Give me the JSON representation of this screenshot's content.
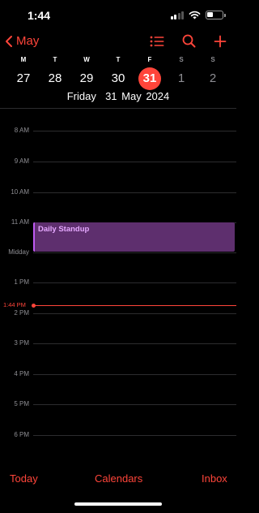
{
  "status_bar": {
    "time": "1:44",
    "icons": [
      "cellular-signal-icon",
      "wifi-icon",
      "battery-icon"
    ]
  },
  "nav": {
    "back_label": "May",
    "actions": [
      "list-icon",
      "search-icon",
      "add-icon"
    ]
  },
  "week": {
    "letters": [
      "M",
      "T",
      "W",
      "T",
      "F",
      "S",
      "S"
    ],
    "days": [
      "27",
      "28",
      "29",
      "30",
      "31",
      "1",
      "2"
    ],
    "selected_index": 4,
    "full_date": "Friday  31 May 2024"
  },
  "timeline": {
    "hours": [
      "8 AM",
      "9 AM",
      "10 AM",
      "11 AM",
      "Midday",
      "1 PM",
      "2 PM",
      "3 PM",
      "4 PM",
      "5 PM",
      "6 PM"
    ],
    "current_time": "1:44 PM",
    "events": [
      {
        "title": "Daily Standup"
      }
    ]
  },
  "tab_bar": {
    "today": "Today",
    "calendars": "Calendars",
    "inbox": "Inbox"
  },
  "colors": {
    "accent": "#ff453a",
    "event_fill": "#5e2f6e",
    "event_accent": "#bf5af2",
    "event_text": "#e5a8ff",
    "background": "#000000",
    "secondary_text": "#8e8e93"
  }
}
